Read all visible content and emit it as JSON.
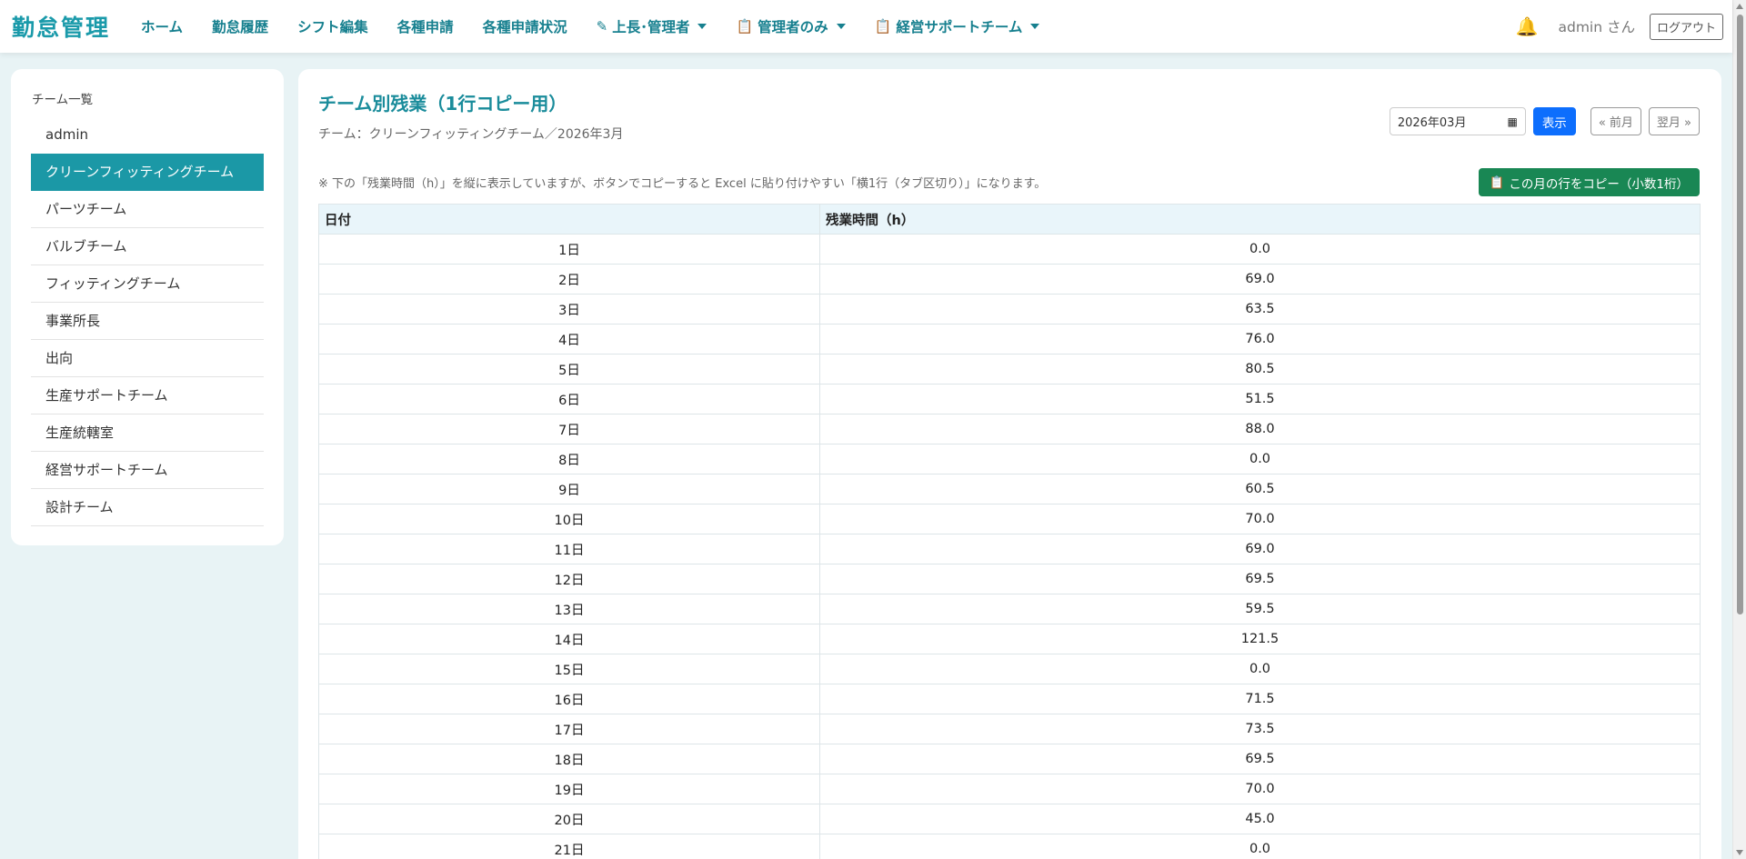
{
  "nav": {
    "brand": "勤怠管理",
    "items": [
      {
        "label": "ホーム",
        "icon": "",
        "dropdown": false
      },
      {
        "label": "勤怠履歴",
        "icon": "",
        "dropdown": false
      },
      {
        "label": "シフト編集",
        "icon": "",
        "dropdown": false
      },
      {
        "label": "各種申請",
        "icon": "",
        "dropdown": false
      },
      {
        "label": "各種申請状況",
        "icon": "",
        "dropdown": false
      },
      {
        "label": "上長･管理者",
        "icon": "edit-icon",
        "dropdown": true
      },
      {
        "label": "管理者のみ",
        "icon": "clipboard-icon",
        "dropdown": true
      },
      {
        "label": "経営サポートチーム",
        "icon": "clipboard-icon",
        "dropdown": true
      }
    ],
    "user": "admin さん",
    "logout": "ログアウト"
  },
  "sidebar": {
    "title": "チーム一覧",
    "items": [
      {
        "label": "admin",
        "active": false
      },
      {
        "label": "クリーンフィッティングチーム",
        "active": true
      },
      {
        "label": "パーツチーム",
        "active": false
      },
      {
        "label": "バルブチーム",
        "active": false
      },
      {
        "label": "フィッティングチーム",
        "active": false
      },
      {
        "label": "事業所長",
        "active": false
      },
      {
        "label": "出向",
        "active": false
      },
      {
        "label": "生産サポートチーム",
        "active": false
      },
      {
        "label": "生産統轄室",
        "active": false
      },
      {
        "label": "経営サポートチーム",
        "active": false
      },
      {
        "label": "設計チーム",
        "active": false
      }
    ]
  },
  "main": {
    "title": "チーム別残業（1行コピー用）",
    "subtitle": "チーム：クリーンフィッティングチーム／2026年3月",
    "month_value": "2026年03月",
    "show_button": "表示",
    "prev_button": "« 前月",
    "next_button": "翌月 »",
    "note": "※ 下の「残業時間（h）」を縦に表示していますが、ボタンでコピーすると Excel に貼り付けやすい「横1行（タブ区切り）」になります。",
    "copy_button": "この月の行をコピー（小数1桁）",
    "table": {
      "headers": [
        "日付",
        "残業時間（h）"
      ],
      "rows": [
        [
          "1日",
          "0.0"
        ],
        [
          "2日",
          "69.0"
        ],
        [
          "3日",
          "63.5"
        ],
        [
          "4日",
          "76.0"
        ],
        [
          "5日",
          "80.5"
        ],
        [
          "6日",
          "51.5"
        ],
        [
          "7日",
          "88.0"
        ],
        [
          "8日",
          "0.0"
        ],
        [
          "9日",
          "60.5"
        ],
        [
          "10日",
          "70.0"
        ],
        [
          "11日",
          "69.0"
        ],
        [
          "12日",
          "69.5"
        ],
        [
          "13日",
          "59.5"
        ],
        [
          "14日",
          "121.5"
        ],
        [
          "15日",
          "0.0"
        ],
        [
          "16日",
          "71.5"
        ],
        [
          "17日",
          "73.5"
        ],
        [
          "18日",
          "69.5"
        ],
        [
          "19日",
          "70.0"
        ],
        [
          "20日",
          "45.0"
        ],
        [
          "21日",
          "0.0"
        ]
      ]
    }
  },
  "colors": {
    "accent": "#1b98a6",
    "primary": "#0d6efd",
    "success": "#198754",
    "background": "#e8f3f5"
  }
}
